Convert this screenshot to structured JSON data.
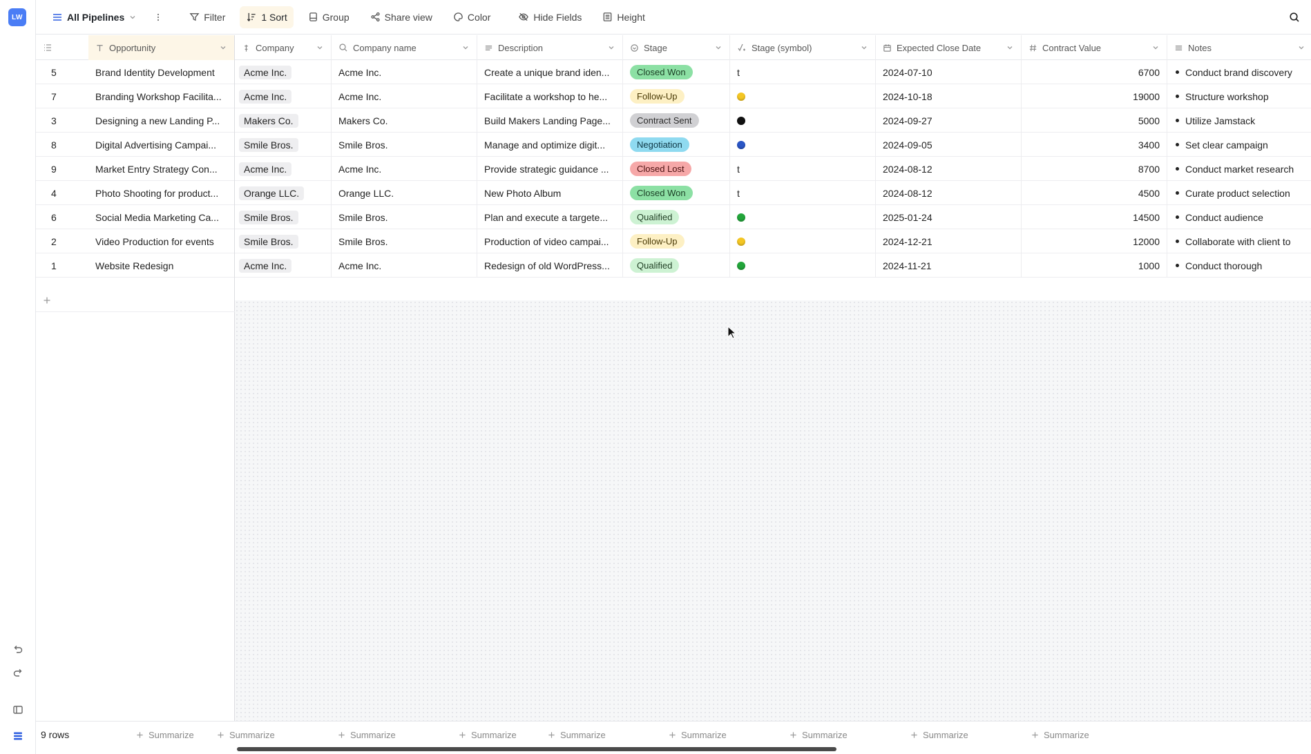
{
  "app": {
    "logo": "LW"
  },
  "toolbar": {
    "view_name": "All Pipelines",
    "filter": "Filter",
    "sort": "1 Sort",
    "group": "Group",
    "share": "Share view",
    "color": "Color",
    "hide_fields": "Hide Fields",
    "height": "Height"
  },
  "columns": {
    "opportunity": "Opportunity",
    "company": "Company",
    "company_name": "Company name",
    "description": "Description",
    "stage": "Stage",
    "stage_symbol": "Stage (symbol)",
    "expected_close": "Expected Close Date",
    "contract_value": "Contract Value",
    "notes": "Notes"
  },
  "rows": [
    {
      "id": "5",
      "opportunity": "Brand Identity Development",
      "company": "Acme Inc.",
      "company_name": "Acme Inc.",
      "description": "Create a unique brand iden...",
      "stage": "Closed Won",
      "symbol": "t",
      "date": "2024-07-10",
      "value": "6700",
      "notes": "Conduct brand discovery"
    },
    {
      "id": "7",
      "opportunity": "Branding Workshop Facilita...",
      "company": "Acme Inc.",
      "company_name": "Acme Inc.",
      "description": "Facilitate a workshop to he...",
      "stage": "Follow-Up",
      "symbol": "",
      "date": "2024-10-18",
      "value": "19000",
      "notes": "Structure workshop"
    },
    {
      "id": "3",
      "opportunity": "Designing a new Landing P...",
      "company": "Makers Co.",
      "company_name": "Makers Co.",
      "description": "Build Makers Landing Page...",
      "stage": "Contract Sent",
      "symbol": "",
      "date": "2024-09-27",
      "value": "5000",
      "notes": "Utilize Jamstack"
    },
    {
      "id": "8",
      "opportunity": "Digital Advertising Campai...",
      "company": "Smile Bros.",
      "company_name": "Smile Bros.",
      "description": "Manage and optimize digit...",
      "stage": "Negotiation",
      "symbol": "",
      "date": "2024-09-05",
      "value": "3400",
      "notes": "Set clear campaign"
    },
    {
      "id": "9",
      "opportunity": "Market Entry Strategy Con...",
      "company": "Acme Inc.",
      "company_name": "Acme Inc.",
      "description": "Provide strategic guidance ...",
      "stage": "Closed Lost",
      "symbol": "t",
      "date": "2024-08-12",
      "value": "8700",
      "notes": "Conduct market research"
    },
    {
      "id": "4",
      "opportunity": "Photo Shooting for product...",
      "company": "Orange LLC.",
      "company_name": "Orange LLC.",
      "description": "New Photo Album",
      "stage": "Closed Won",
      "symbol": "t",
      "date": "2024-08-12",
      "value": "4500",
      "notes": "Curate product selection"
    },
    {
      "id": "6",
      "opportunity": "Social Media Marketing Ca...",
      "company": "Smile Bros.",
      "company_name": "Smile Bros.",
      "description": "Plan and execute a targete...",
      "stage": "Qualified",
      "symbol": "",
      "date": "2025-01-24",
      "value": "14500",
      "notes": "Conduct audience"
    },
    {
      "id": "2",
      "opportunity": "Video Production for events",
      "company": "Smile Bros.",
      "company_name": "Smile Bros.",
      "description": "Production of video campai...",
      "stage": "Follow-Up",
      "symbol": "",
      "date": "2024-12-21",
      "value": "12000",
      "notes": "Collaborate with client to"
    },
    {
      "id": "1",
      "opportunity": "Website Redesign",
      "company": "Acme Inc.",
      "company_name": "Acme Inc.",
      "description": "Redesign of old WordPress...",
      "stage": "Qualified",
      "symbol": "",
      "date": "2024-11-21",
      "value": "1000",
      "notes": "Conduct thorough"
    }
  ],
  "stage_colors": {
    "Closed Won": {
      "bg": "#8ce0a4",
      "fg": "#1a3d24"
    },
    "Follow-Up": {
      "bg": "#fdf0c4",
      "fg": "#4a3a05"
    },
    "Contract Sent": {
      "bg": "#d0d0d3",
      "fg": "#2b2b2b"
    },
    "Negotiation": {
      "bg": "#8fdaf0",
      "fg": "#0e3644"
    },
    "Closed Lost": {
      "bg": "#f6a8a8",
      "fg": "#4a1010"
    },
    "Qualified": {
      "bg": "#cdf2d3",
      "fg": "#1e3d22"
    }
  },
  "symbol_dots": {
    "Follow-Up": "#f4c623",
    "Contract Sent": "#111111",
    "Negotiation": "#2a56c6",
    "Qualified": "#22a53a"
  },
  "footer": {
    "rows_count": "9 rows",
    "summarize": "Summarize"
  }
}
